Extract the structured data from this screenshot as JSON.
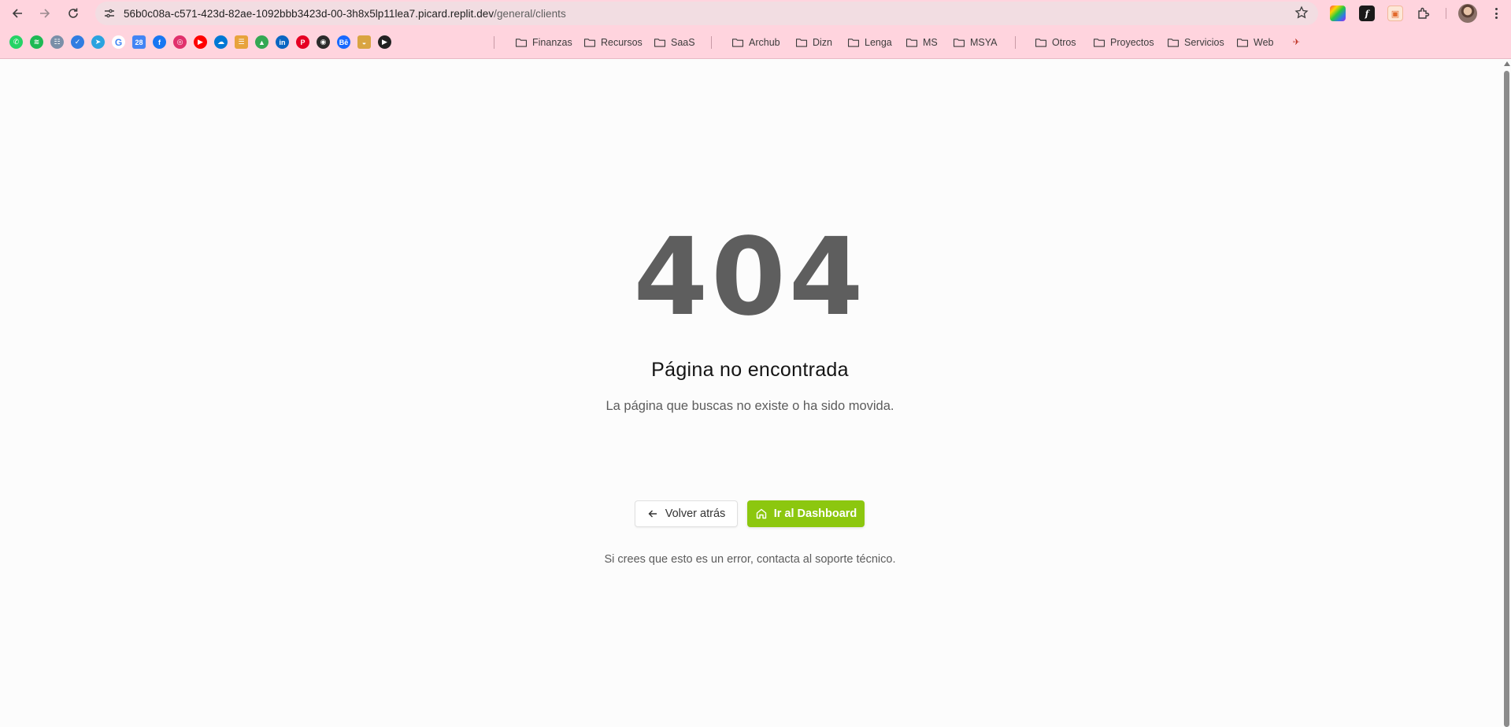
{
  "browser": {
    "url_host": "56b0c08a-c571-423d-82ae-1092bbb3423d-00-3h8x5lp11lea7.picard.replit.dev",
    "url_path": "/general/clients",
    "bookmark_icons": [
      {
        "name": "whatsapp",
        "color": "#25d366",
        "glyph": "✆"
      },
      {
        "name": "spotify",
        "color": "#1db954",
        "glyph": "≋"
      },
      {
        "name": "groups",
        "color": "#7a8fa8",
        "glyph": "☷"
      },
      {
        "name": "check-app",
        "color": "#2f7de1",
        "glyph": "✓"
      },
      {
        "name": "telegram",
        "color": "#2aa3df",
        "glyph": "➤"
      },
      {
        "name": "google",
        "color": "#ffffff",
        "glyph": "G"
      },
      {
        "name": "calendar",
        "color": "#4285f4",
        "glyph": "28"
      },
      {
        "name": "facebook",
        "color": "#1877f2",
        "glyph": "f"
      },
      {
        "name": "instagram",
        "color": "#e1306c",
        "glyph": "◎"
      },
      {
        "name": "youtube",
        "color": "#ff0000",
        "glyph": "▶"
      },
      {
        "name": "onedrive",
        "color": "#0078d4",
        "glyph": "☁"
      },
      {
        "name": "tasks",
        "color": "#e8a33c",
        "glyph": "☰"
      },
      {
        "name": "drive",
        "color": "#34a853",
        "glyph": "▲"
      },
      {
        "name": "linkedin",
        "color": "#0a66c2",
        "glyph": "in"
      },
      {
        "name": "pinterest",
        "color": "#e60023",
        "glyph": "P"
      },
      {
        "name": "globe",
        "color": "#2b2b2b",
        "glyph": "◉"
      },
      {
        "name": "behance",
        "color": "#1769ff",
        "glyph": "Bē"
      },
      {
        "name": "bread",
        "color": "#d9a441",
        "glyph": "◒"
      },
      {
        "name": "play-circle",
        "color": "#222222",
        "glyph": "▶"
      }
    ],
    "folders_group1": [
      "Finanzas",
      "Recursos",
      "SaaS"
    ],
    "folders_group2": [
      "Archub",
      "Dizn",
      "Lenga",
      "MS",
      "MSYA"
    ],
    "folders_group3": [
      "Otros",
      "Proyectos",
      "Servicios",
      "Web"
    ]
  },
  "page": {
    "code": "404",
    "title": "Página no encontrada",
    "description": "La página que buscas no existe o ha sido movida.",
    "back_button": "Volver atrás",
    "dashboard_button": "Ir al Dashboard",
    "footnote": "Si crees que esto es un error, contacta al soporte técnico.",
    "accent_color": "#8cc70f"
  }
}
